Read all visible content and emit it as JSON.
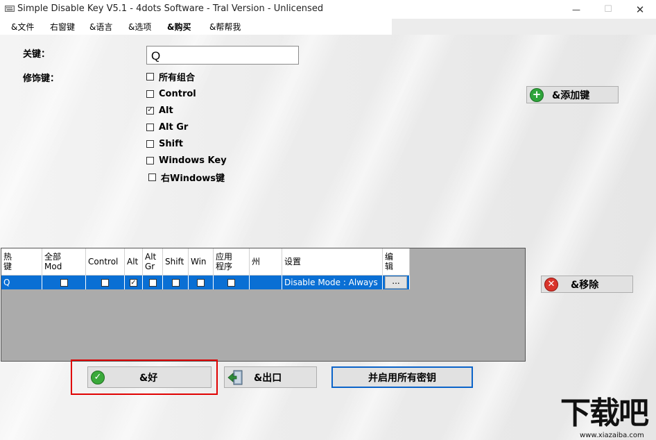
{
  "window": {
    "title": "Simple Disable Key V5.1 - 4dots Software - Tral Version - Unlicensed",
    "minimize": "—",
    "maximize": "☐",
    "close": "✕"
  },
  "menu": [
    "&文件",
    "右窗键",
    "&语言",
    "&选项",
    "&购买",
    "&帮帮我"
  ],
  "form": {
    "key_label": "关键：",
    "key_value": "Q",
    "modifier_label": "修饰键：",
    "modifiers": [
      {
        "label": "所有组合",
        "checked": false
      },
      {
        "label": "Control",
        "checked": false
      },
      {
        "label": "Alt",
        "checked": true
      },
      {
        "label": "Alt Gr",
        "checked": false
      },
      {
        "label": "Shift",
        "checked": false
      },
      {
        "label": "Windows Key",
        "checked": false
      },
      {
        "label": "右Windows键",
        "checked": false
      }
    ]
  },
  "buttons": {
    "add_key": "&添加键",
    "remove": "&移除",
    "ok": "&好",
    "exit": "&出口",
    "enable_all": "并启用所有密钥"
  },
  "grid": {
    "headers": [
      "热\n键",
      "全部\nMod",
      "Control",
      "Alt",
      "Alt\nGr",
      "Shift",
      "Win",
      "应用\n程序",
      "州",
      "设置",
      "编\n辑"
    ],
    "row": {
      "key": "Q",
      "all_mod": false,
      "control": false,
      "alt": true,
      "alt_gr": false,
      "shift": false,
      "win": false,
      "app": false,
      "state": "",
      "settings": "Disable Mode : Always",
      "edit": "..."
    }
  },
  "watermark": {
    "text": "下载吧",
    "url": "www.xiazaiba.com"
  },
  "colors": {
    "selection": "#0a6fd4",
    "highlight_border": "#e00000",
    "focus_border": "#0a63c9"
  }
}
